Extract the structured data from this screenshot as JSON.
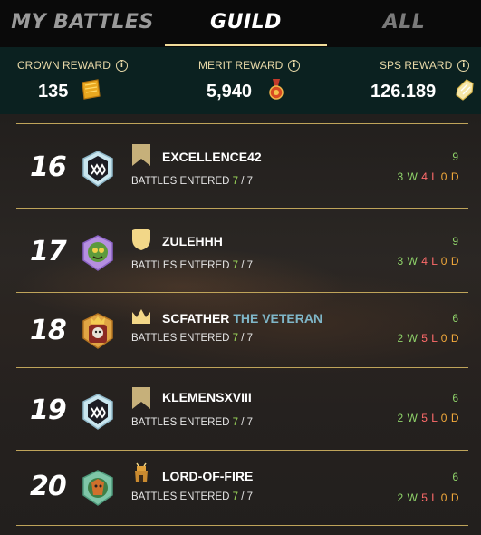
{
  "tabs": {
    "my_battles": "MY BATTLES",
    "guild": "GUILD",
    "all": "ALL"
  },
  "rewards": {
    "crown": {
      "label": "CROWN REWARD",
      "value": "135",
      "icon": "crown-token-icon"
    },
    "merit": {
      "label": "MERIT REWARD",
      "value": "5,940",
      "icon": "merit-medal-icon"
    },
    "sps": {
      "label": "SPS REWARD",
      "value": "126.189",
      "icon": "sps-crystal-icon"
    }
  },
  "battles_label": "BATTLES ENTERED",
  "rows": [
    {
      "rank": "16",
      "name": "EXCELLENCE42",
      "title": "",
      "entered": "7",
      "total": "7",
      "score": "9",
      "wins": "3",
      "losses": "4",
      "draws": "0",
      "badge": "banner-badge-icon"
    },
    {
      "rank": "17",
      "name": "ZULEHHH",
      "title": "",
      "entered": "7",
      "total": "7",
      "score": "9",
      "wins": "3",
      "losses": "4",
      "draws": "0",
      "badge": "shield-badge-icon"
    },
    {
      "rank": "18",
      "name": "SCFATHER",
      "title": "THE VETERAN",
      "entered": "7",
      "total": "7",
      "score": "6",
      "wins": "2",
      "losses": "5",
      "draws": "0",
      "badge": "crown-badge-icon"
    },
    {
      "rank": "19",
      "name": "KLEMENSXVIII",
      "title": "",
      "entered": "7",
      "total": "7",
      "score": "6",
      "wins": "2",
      "losses": "5",
      "draws": "0",
      "badge": "banner-badge-icon"
    },
    {
      "rank": "20",
      "name": "LORD-OF-FIRE",
      "title": "",
      "entered": "7",
      "total": "7",
      "score": "6",
      "wins": "2",
      "losses": "5",
      "draws": "0",
      "badge": "tower-badge-icon"
    }
  ],
  "colors": {
    "accent": "#f1dc9a",
    "win": "#8fd36a",
    "loss": "#ff6b6b",
    "draw": "#f2a93b",
    "title": "#7fb6c8"
  }
}
